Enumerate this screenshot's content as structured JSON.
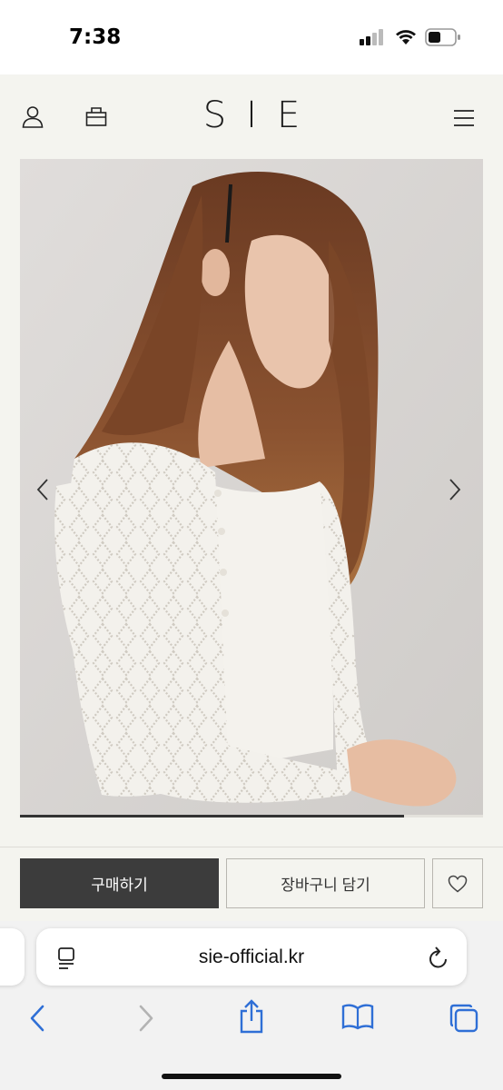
{
  "status_bar": {
    "time": "7:38"
  },
  "header": {
    "logo": "SIE",
    "icons": [
      "user-icon",
      "bag-icon",
      "menu-icon"
    ]
  },
  "carousel": {
    "image_description": "model in white pointelle knit cardigan over white top",
    "progress": 0.83
  },
  "actions": {
    "buy_label": "구매하기",
    "cart_label": "장바구니 담기",
    "wish_icon": "heart-icon"
  },
  "browser": {
    "url": "sie-official.kr",
    "toolbar_icons": [
      "back-icon",
      "forward-icon",
      "share-icon",
      "bookmarks-icon",
      "tabs-icon"
    ]
  },
  "colors": {
    "page_bg": "#f4f4ef",
    "buy_button_bg": "#3c3c3c",
    "safari_accent": "#2f6fd6"
  }
}
